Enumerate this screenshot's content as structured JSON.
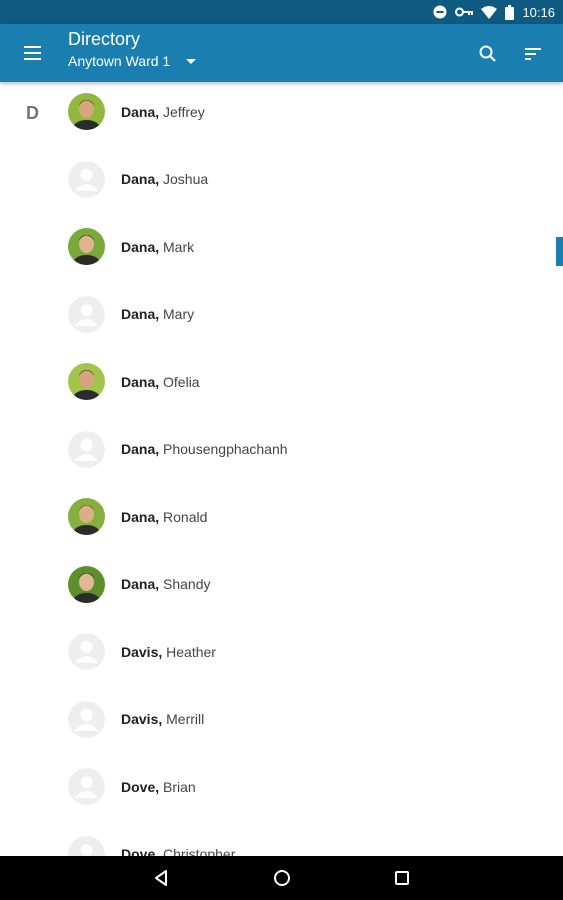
{
  "status_bar": {
    "time": "10:16",
    "icons": [
      "do-not-disturb-icon",
      "vpn-key-icon",
      "wifi-icon",
      "battery-icon"
    ]
  },
  "app_bar": {
    "title": "Directory",
    "subtitle": "Anytown Ward 1",
    "icons": [
      "menu-icon",
      "dropdown-caret-icon",
      "search-icon",
      "sort-icon"
    ],
    "color": "#1a7fb0"
  },
  "directory": {
    "section_letter": "D",
    "rows": [
      {
        "last": "Dana,",
        "first": " Jeffrey",
        "photo": true
      },
      {
        "last": "Dana,",
        "first": " Joshua",
        "photo": false
      },
      {
        "last": "Dana,",
        "first": " Mark",
        "photo": true
      },
      {
        "last": "Dana,",
        "first": " Mary",
        "photo": false
      },
      {
        "last": "Dana,",
        "first": " Ofelia",
        "photo": true
      },
      {
        "last": "Dana,",
        "first": " Phousengphachanh",
        "photo": false
      },
      {
        "last": "Dana,",
        "first": " Ronald",
        "photo": true
      },
      {
        "last": "Dana,",
        "first": " Shandy",
        "photo": true
      },
      {
        "last": "Davis,",
        "first": " Heather",
        "photo": false
      },
      {
        "last": "Davis,",
        "first": " Merrill",
        "photo": false
      },
      {
        "last": "Dove,",
        "first": " Brian",
        "photo": false
      },
      {
        "last": "Dove,",
        "first": " Christopher",
        "photo": false
      }
    ]
  },
  "nav_bar": {
    "icons": [
      "back-icon",
      "home-icon",
      "recents-icon"
    ]
  }
}
